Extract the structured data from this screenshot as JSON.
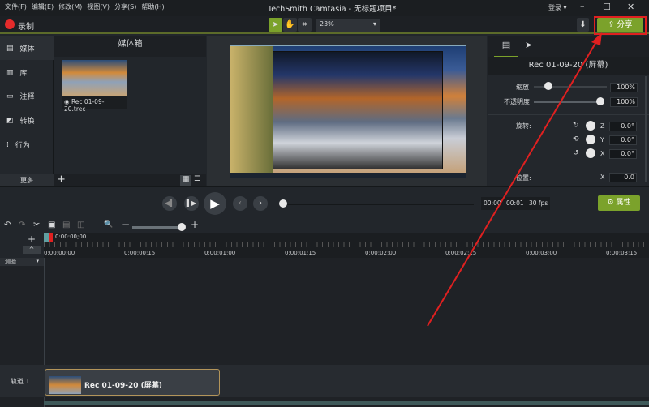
{
  "menu": [
    "文件(F)",
    "编辑(E)",
    "修改(M)",
    "视图(V)",
    "分享(S)",
    "帮助(H)"
  ],
  "window_title": "TechSmith Camtasia - 无标题项目*",
  "login": "登录 ▾",
  "record_label": "录制",
  "zoom_level": "23%",
  "share_label": "分享",
  "nav": [
    "媒体",
    "库",
    "注释",
    "转换",
    "行为"
  ],
  "more_label": "更多",
  "bin_title": "媒体箱",
  "media_item": "Rec 01-09-20.trec",
  "props": {
    "clip_title": "Rec 01-09-20 (屏幕)",
    "scale_label": "缩放",
    "scale": "100%",
    "opacity_label": "不透明度",
    "opacity": "100%",
    "rotation_label": "旋转:",
    "rz": "0.0°",
    "ry": "0.0°",
    "rx": "0.0°",
    "position_label": "位置:",
    "px": "0.0",
    "axis_z": "Z",
    "axis_y": "Y",
    "axis_x": "X"
  },
  "playback": {
    "time": "00:00",
    "frame": "00:01",
    "fps": "30 fps",
    "properties_label": "属性"
  },
  "timeline": {
    "playhead": "0:00:00;00",
    "ruler": [
      "0:00:00;00",
      "0:00:00;15",
      "0:00:01;00",
      "0:00:01;15",
      "0:00:02;00",
      "0:00:02;15",
      "0:00:03;00",
      "0:00:03;15"
    ],
    "marker_label": "测验",
    "track_label": "轨道 1",
    "clip_label": "Rec 01-09-20 (屏幕)"
  },
  "colors": {
    "accent": "#7ba22b",
    "record": "#e52b2b",
    "annotation": "#e02020"
  }
}
